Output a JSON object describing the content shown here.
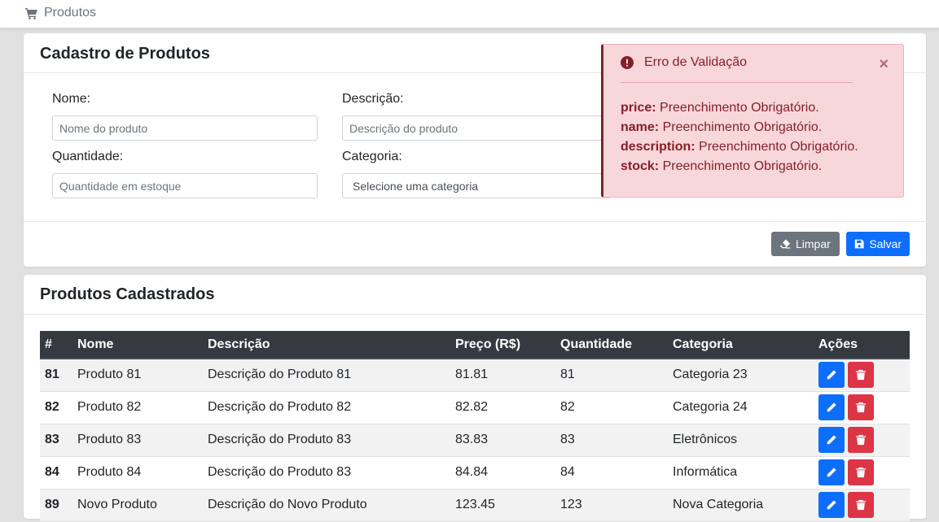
{
  "breadcrumb": {
    "label": "Produtos",
    "icon": "cart-icon"
  },
  "form": {
    "title": "Cadastro de Produtos",
    "name_label": "Nome:",
    "name_placeholder": "Nome do produto",
    "description_label": "Descrição:",
    "description_placeholder": "Descrição do produto",
    "quantity_label": "Quantidade:",
    "quantity_placeholder": "Quantidade em estoque",
    "category_label": "Categoria:",
    "category_selected": "Selecione uma categoria",
    "clear_label": "Limpar",
    "save_label": "Salvar"
  },
  "alert": {
    "title": "Erro de Validação",
    "close": "×",
    "errors": [
      {
        "field": "price:",
        "message": "Preenchimento Obrigatório."
      },
      {
        "field": "name:",
        "message": "Preenchimento Obrigatório."
      },
      {
        "field": "description:",
        "message": "Preenchimento Obrigatório."
      },
      {
        "field": "stock:",
        "message": "Preenchimento Obrigatório."
      }
    ]
  },
  "table": {
    "title": "Produtos Cadastrados",
    "headers": [
      "#",
      "Nome",
      "Descrição",
      "Preço (R$)",
      "Quantidade",
      "Categoria",
      "Ações"
    ],
    "rows": [
      {
        "id": "81",
        "name": "Produto 81",
        "description": "Descrição do Produto 81",
        "price": "81.81",
        "quantity": "81",
        "category": "Categoria 23"
      },
      {
        "id": "82",
        "name": "Produto 82",
        "description": "Descrição do Produto 82",
        "price": "82.82",
        "quantity": "82",
        "category": "Categoria 24"
      },
      {
        "id": "83",
        "name": "Produto 83",
        "description": "Descrição do Produto 83",
        "price": "83.83",
        "quantity": "83",
        "category": "Eletrônicos"
      },
      {
        "id": "84",
        "name": "Produto 84",
        "description": "Descrição do Produto 83",
        "price": "84.84",
        "quantity": "84",
        "category": "Informática"
      },
      {
        "id": "89",
        "name": "Novo Produto",
        "description": "Descrição do Novo Produto",
        "price": "123.45",
        "quantity": "123",
        "category": "Nova Categoria"
      }
    ]
  },
  "colors": {
    "primary": "#0d6efd",
    "danger": "#dc3545",
    "secondary": "#6c757d",
    "table_header": "#343a40",
    "alert_bg": "#f8d7da",
    "alert_text": "#842029"
  }
}
